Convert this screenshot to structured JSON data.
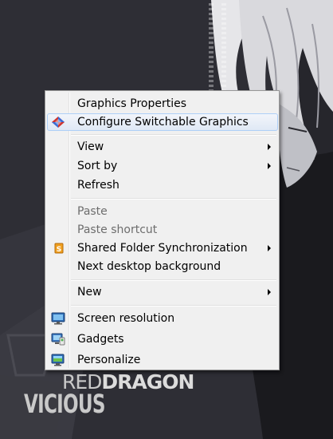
{
  "wallpaper": {
    "brand_light": "RED",
    "brand_bold": "DRAGON",
    "signature": "VICIOUS"
  },
  "context_menu": {
    "items": [
      {
        "label": "Graphics Properties",
        "enabled": true,
        "submenu": false,
        "icon": ""
      },
      {
        "label": "Configure Switchable Graphics",
        "enabled": true,
        "submenu": false,
        "icon": "switchable-graphics-icon",
        "highlighted": true
      },
      {
        "label": "View",
        "enabled": true,
        "submenu": true,
        "icon": ""
      },
      {
        "label": "Sort by",
        "enabled": true,
        "submenu": true,
        "icon": ""
      },
      {
        "label": "Refresh",
        "enabled": true,
        "submenu": false,
        "icon": ""
      },
      {
        "label": "Paste",
        "enabled": false,
        "submenu": false,
        "icon": ""
      },
      {
        "label": "Paste shortcut",
        "enabled": false,
        "submenu": false,
        "icon": ""
      },
      {
        "label": "Shared Folder Synchronization",
        "enabled": true,
        "submenu": true,
        "icon": "shared-folder-sync-icon"
      },
      {
        "label": "Next desktop background",
        "enabled": true,
        "submenu": false,
        "icon": ""
      },
      {
        "label": "New",
        "enabled": true,
        "submenu": true,
        "icon": ""
      },
      {
        "label": "Screen resolution",
        "enabled": true,
        "submenu": false,
        "icon": "screen-resolution-icon"
      },
      {
        "label": "Gadgets",
        "enabled": true,
        "submenu": false,
        "icon": "gadgets-icon"
      },
      {
        "label": "Personalize",
        "enabled": true,
        "submenu": false,
        "icon": "personalize-icon"
      }
    ]
  },
  "colors": {
    "menu_background": "#f0f0f0",
    "highlight_border": "#aecff7",
    "disabled_text": "#6d6d6d"
  }
}
